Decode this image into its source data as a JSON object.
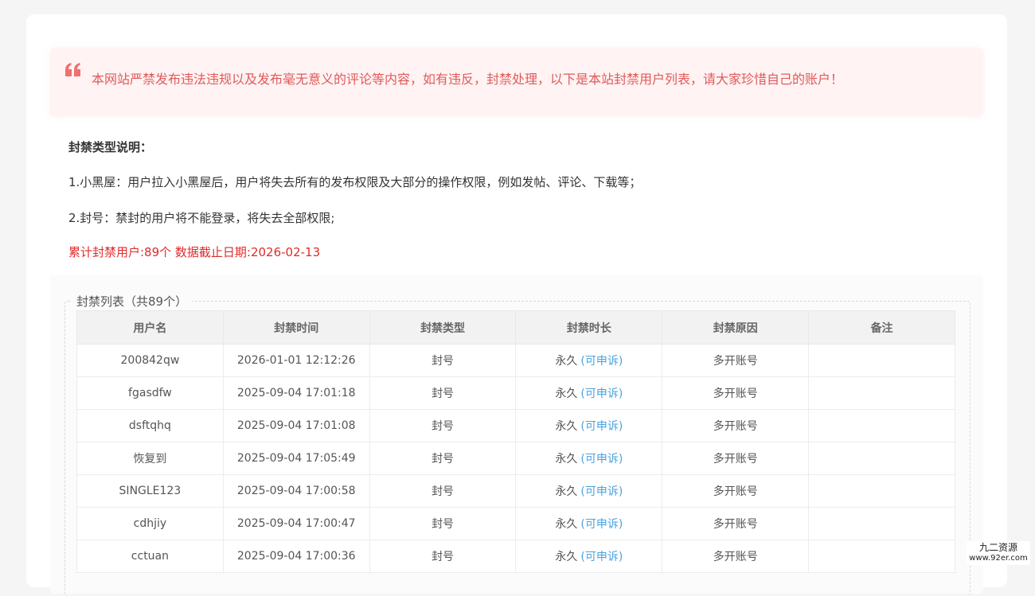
{
  "notice": {
    "text": "本网站严禁发布违法违规以及发布毫无意义的评论等内容，如有违反，封禁处理，以下是本站封禁用户列表，请大家珍惜自己的账户！"
  },
  "explanation": {
    "title": "封禁类型说明：",
    "line1": "1.小黑屋：用户拉入小黑屋后，用户将失去所有的发布权限及大部分的操作权限，例如发帖、评论、下载等；",
    "line2": "2.封号：禁封的用户将不能登录，将失去全部权限;",
    "stats": "累计封禁用户:89个 数据截止日期:2026-02-13"
  },
  "list": {
    "legend": "封禁列表（共89个）",
    "headers": [
      "用户名",
      "封禁时间",
      "封禁类型",
      "封禁时长",
      "封禁原因",
      "备注"
    ],
    "rows": [
      {
        "user": "200842qw",
        "time": "2026-01-01 12:12:26",
        "type": "封号",
        "duration": "永久",
        "appeal": "(可申诉)",
        "reason": "多开账号",
        "note": ""
      },
      {
        "user": "fgasdfw",
        "time": "2025-09-04 17:01:18",
        "type": "封号",
        "duration": "永久",
        "appeal": "(可申诉)",
        "reason": "多开账号",
        "note": ""
      },
      {
        "user": "dsftqhq",
        "time": "2025-09-04 17:01:08",
        "type": "封号",
        "duration": "永久",
        "appeal": "(可申诉)",
        "reason": "多开账号",
        "note": ""
      },
      {
        "user": "恢复到",
        "time": "2025-09-04 17:05:49",
        "type": "封号",
        "duration": "永久",
        "appeal": "(可申诉)",
        "reason": "多开账号",
        "note": ""
      },
      {
        "user": "SINGLE123",
        "time": "2025-09-04 17:00:58",
        "type": "封号",
        "duration": "永久",
        "appeal": "(可申诉)",
        "reason": "多开账号",
        "note": ""
      },
      {
        "user": "cdhjiy",
        "time": "2025-09-04 17:00:47",
        "type": "封号",
        "duration": "永久",
        "appeal": "(可申诉)",
        "reason": "多开账号",
        "note": ""
      },
      {
        "user": "cctuan",
        "time": "2025-09-04 17:00:36",
        "type": "封号",
        "duration": "永久",
        "appeal": "(可申诉)",
        "reason": "多开账号",
        "note": ""
      }
    ]
  },
  "watermark": {
    "name": "九二资源",
    "url": "www.92er.com"
  },
  "colors": {
    "notice_text": "#e05a5a",
    "stats_text": "#e02b2b",
    "appeal_link": "#4aa3df"
  },
  "icons": {
    "notice": "quote-icon"
  }
}
